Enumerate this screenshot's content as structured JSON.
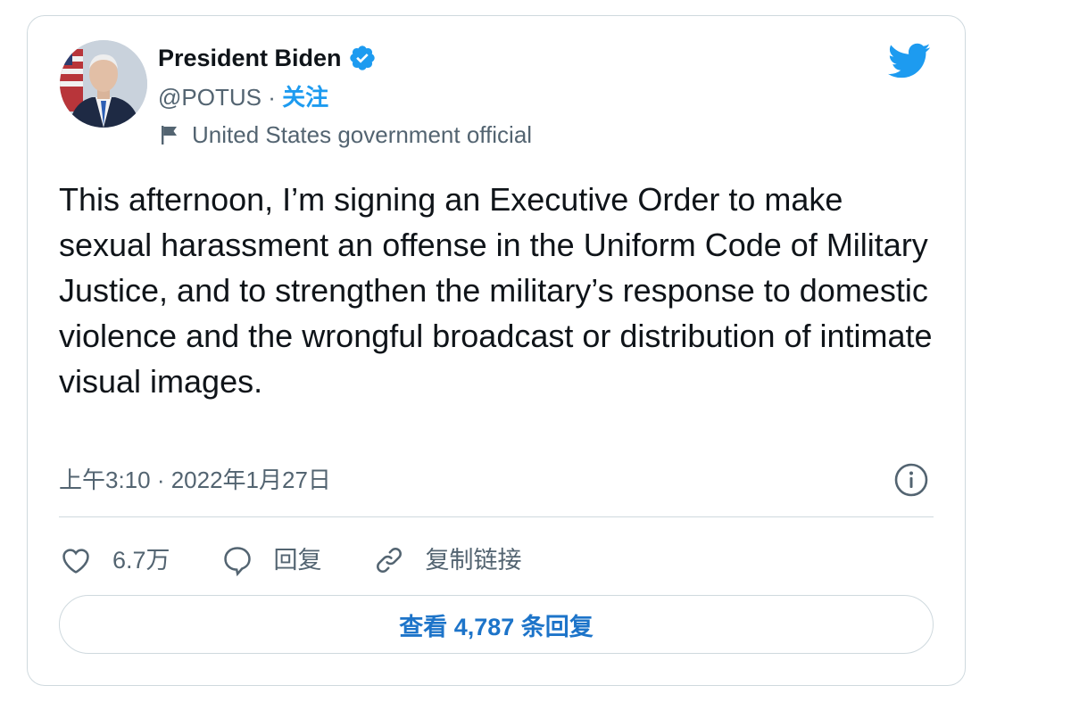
{
  "author": {
    "name": "President Biden",
    "handle": "@POTUS",
    "separator": " · ",
    "follow_label": "关注",
    "account_label": "United States government official"
  },
  "tweet": {
    "text": "This afternoon, I’m signing an Executive Order to make sexual harassment an offense in the Uniform Code of Military Justice, and to strengthen the military’s response to domestic violence and the wrongful broadcast or distribution of intimate visual images.",
    "timestamp": "上午3:10 · 2022年1月27日"
  },
  "actions": {
    "like_count": "6.7万",
    "reply_label": "回复",
    "copy_link_label": "复制链接"
  },
  "replies_button": {
    "label": "查看 4,787 条回复"
  },
  "icons": {
    "verified": "verified-badge-icon",
    "logo": "twitter-bird-icon",
    "flag": "flag-icon",
    "info": "info-icon",
    "like": "heart-icon",
    "reply": "speech-bubble-icon",
    "link": "link-icon"
  },
  "colors": {
    "accent": "#1d9bf0",
    "text": "#0f1419",
    "secondary": "#536471",
    "border": "#cfd9de",
    "button_text": "#1d74c9"
  }
}
